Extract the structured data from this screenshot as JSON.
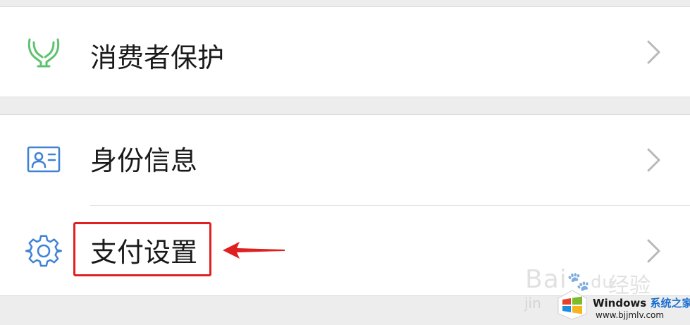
{
  "settings": {
    "items": [
      {
        "label": "消费者保护",
        "icon": "hands-protect-icon",
        "icon_color": "#5ec26f"
      },
      {
        "label": "身份信息",
        "icon": "id-card-icon",
        "icon_color": "#3f82d6"
      },
      {
        "label": "支付设置",
        "icon": "gear-icon",
        "icon_color": "#3f82d6"
      }
    ]
  },
  "annotation": {
    "box_color": "#e02020",
    "arrow_color": "#e02020"
  },
  "watermark": {
    "baidu_brand": "Bai",
    "baidu_brand_suffix": "du",
    "jingyan_label": "经验",
    "jingyan_sub": "jin"
  },
  "badge": {
    "title": "Windows",
    "title_cn": "系统之家",
    "url": "www.bjjmlv.com"
  },
  "colors": {
    "background": "#ededed",
    "card": "#ffffff",
    "chevron": "#b8b8b8",
    "text": "#1a1a1a"
  }
}
